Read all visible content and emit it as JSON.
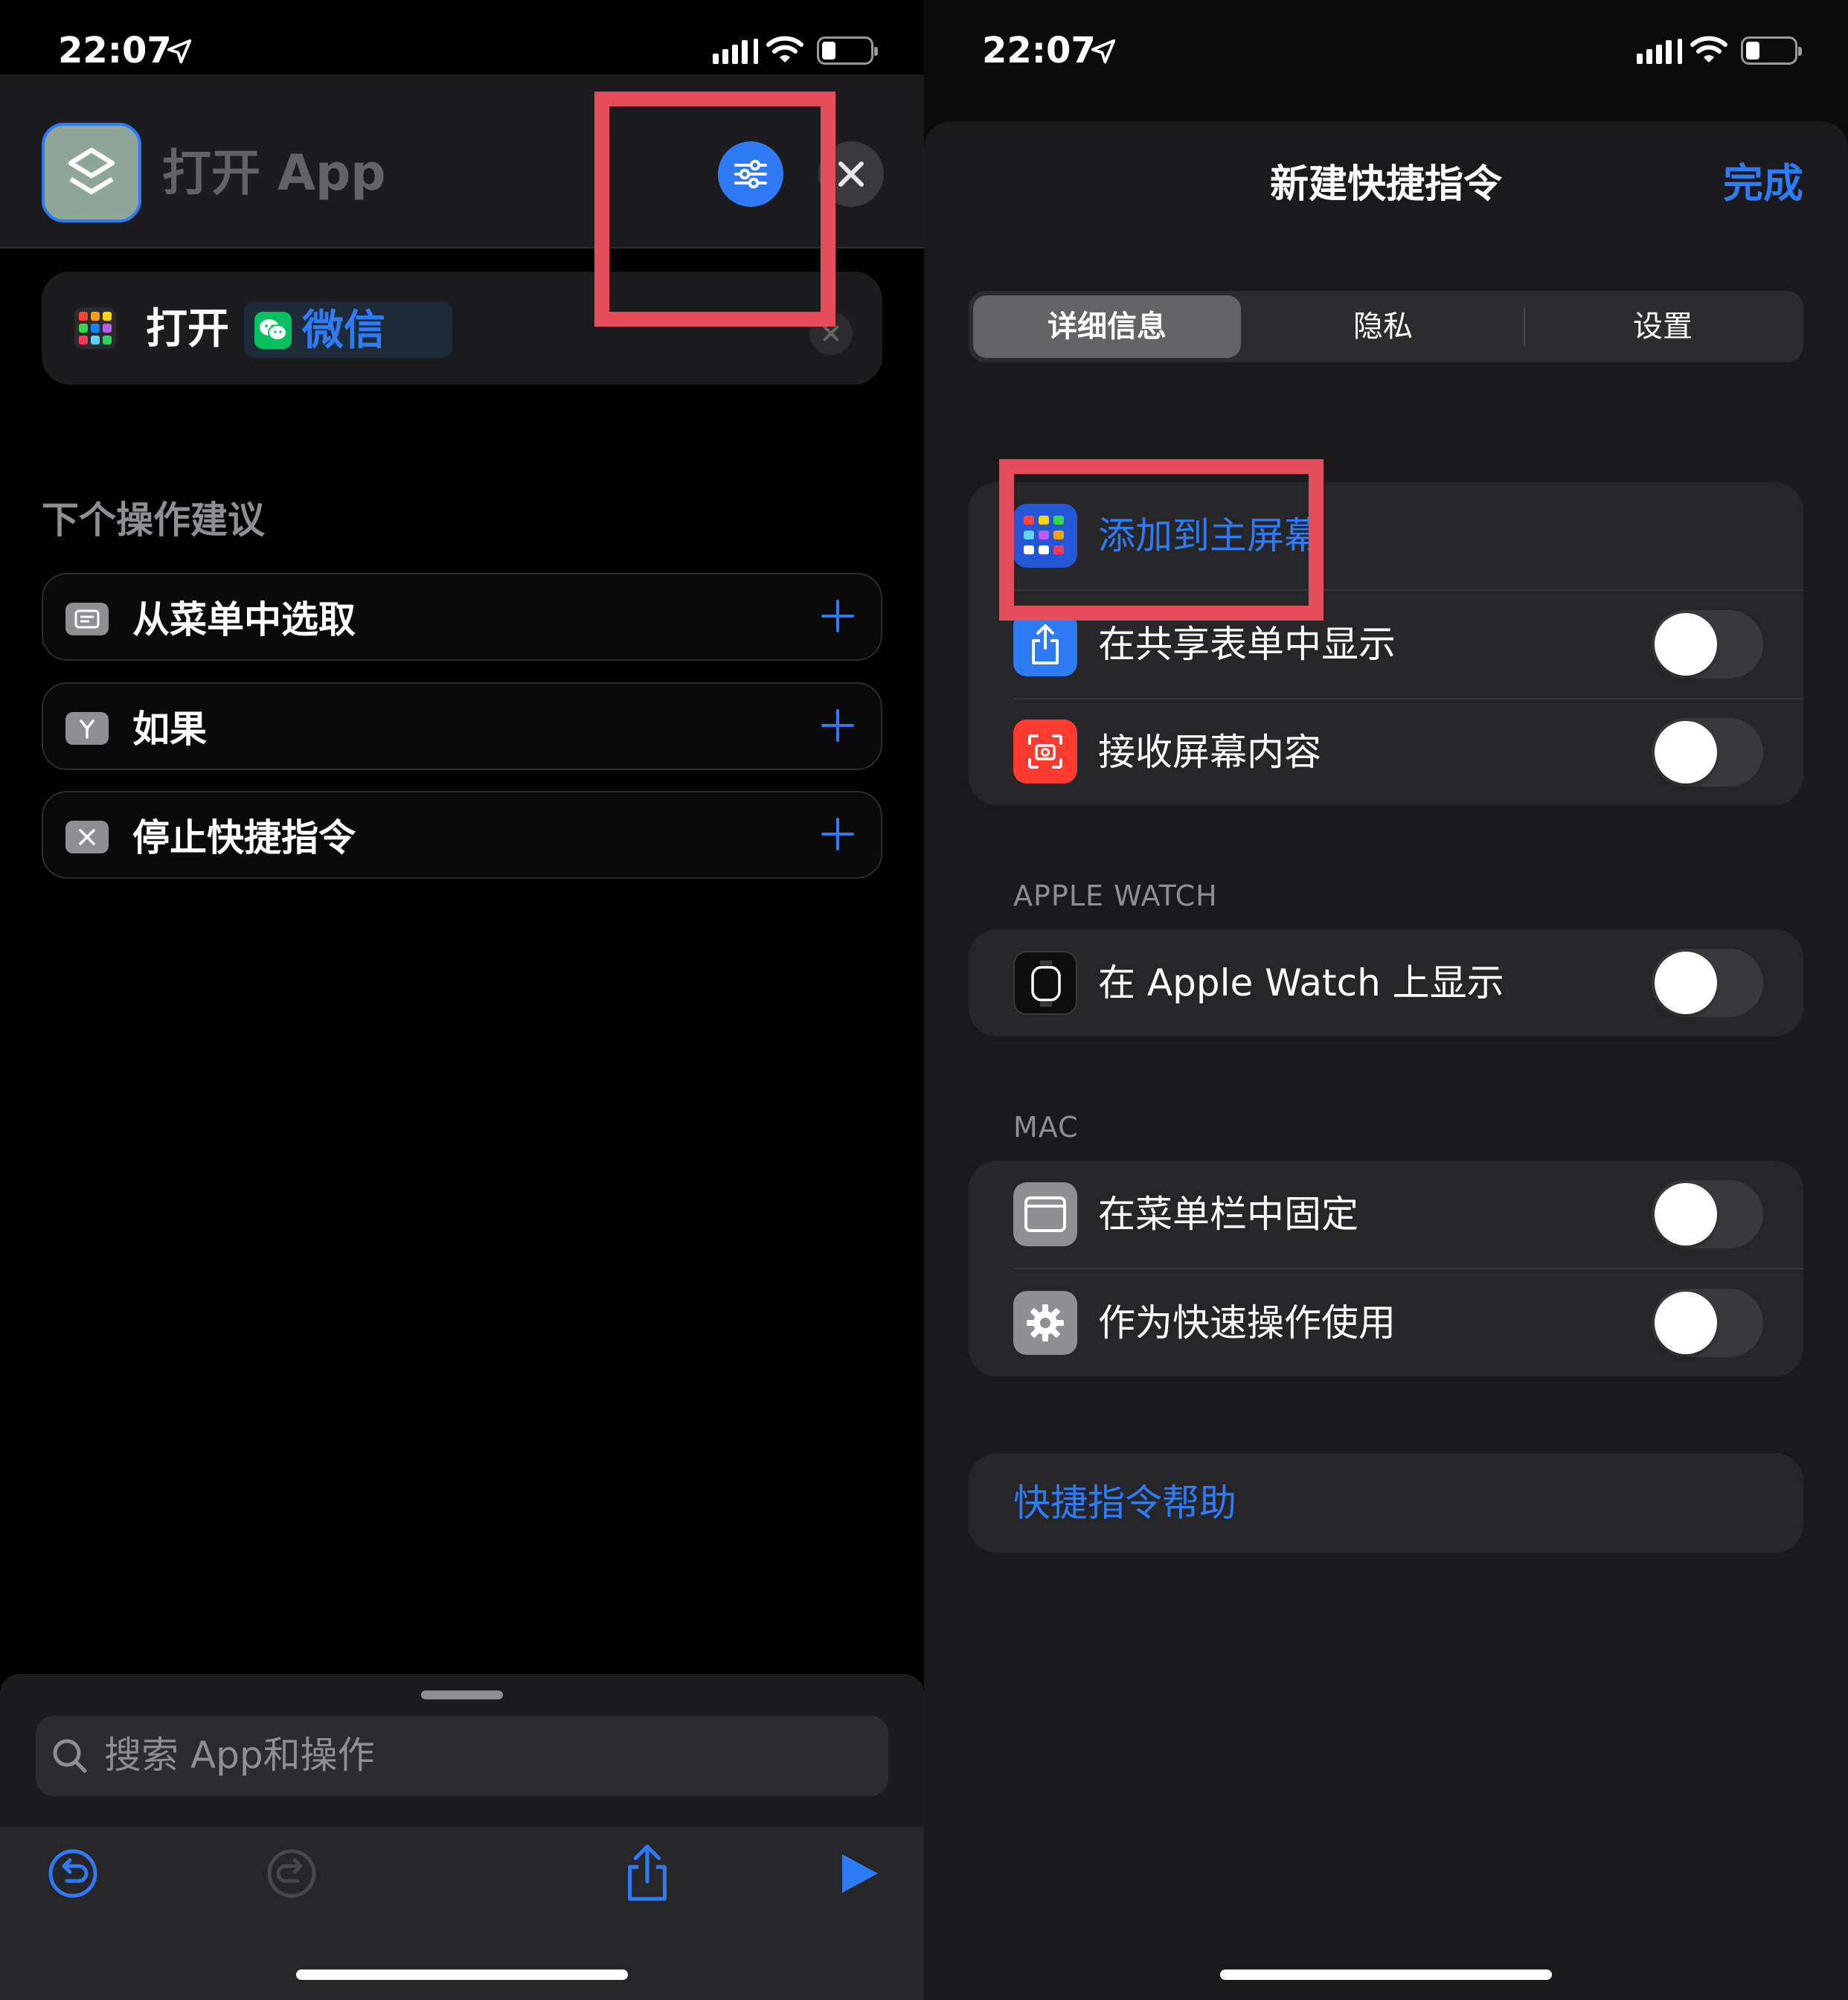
{
  "left_screen": {
    "status_time": "22:07",
    "app_title": "打开 App",
    "action": {
      "verb": "打开",
      "app_name": "微信"
    },
    "suggestions_header": "下个操作建议",
    "suggestions": [
      {
        "label": "从菜单中选取",
        "icon": "menu-icon"
      },
      {
        "label": "如果",
        "icon": "branch-icon"
      },
      {
        "label": "停止快捷指令",
        "icon": "close-icon"
      }
    ],
    "search_placeholder": "搜索 App和操作"
  },
  "right_screen": {
    "status_time": "22:07",
    "title": "新建快捷指令",
    "done_label": "完成",
    "tabs": [
      {
        "label": "详细信息",
        "selected": true
      },
      {
        "label": "隐私",
        "selected": false
      },
      {
        "label": "设置",
        "selected": false
      }
    ],
    "main_rows": {
      "add_home": "添加到主屏幕",
      "share_sheet": "在共享表单中显示",
      "screen_content": "接收屏幕内容"
    },
    "apple_watch_header": "APPLE WATCH",
    "apple_watch_row": "在 Apple Watch 上显示",
    "mac_header": "MAC",
    "mac_rows": {
      "menubar": "在菜单栏中固定",
      "quick_action": "作为快速操作使用"
    },
    "help_link": "快捷指令帮助",
    "toggles": {
      "share_sheet": false,
      "screen_content": false,
      "apple_watch": false,
      "menubar": false,
      "quick_action": false
    }
  },
  "colors": {
    "accent": "#2f7bf6",
    "highlight_box": "#e74c5a",
    "wechat_green": "#07c160",
    "panel": "#1c1c1e"
  }
}
